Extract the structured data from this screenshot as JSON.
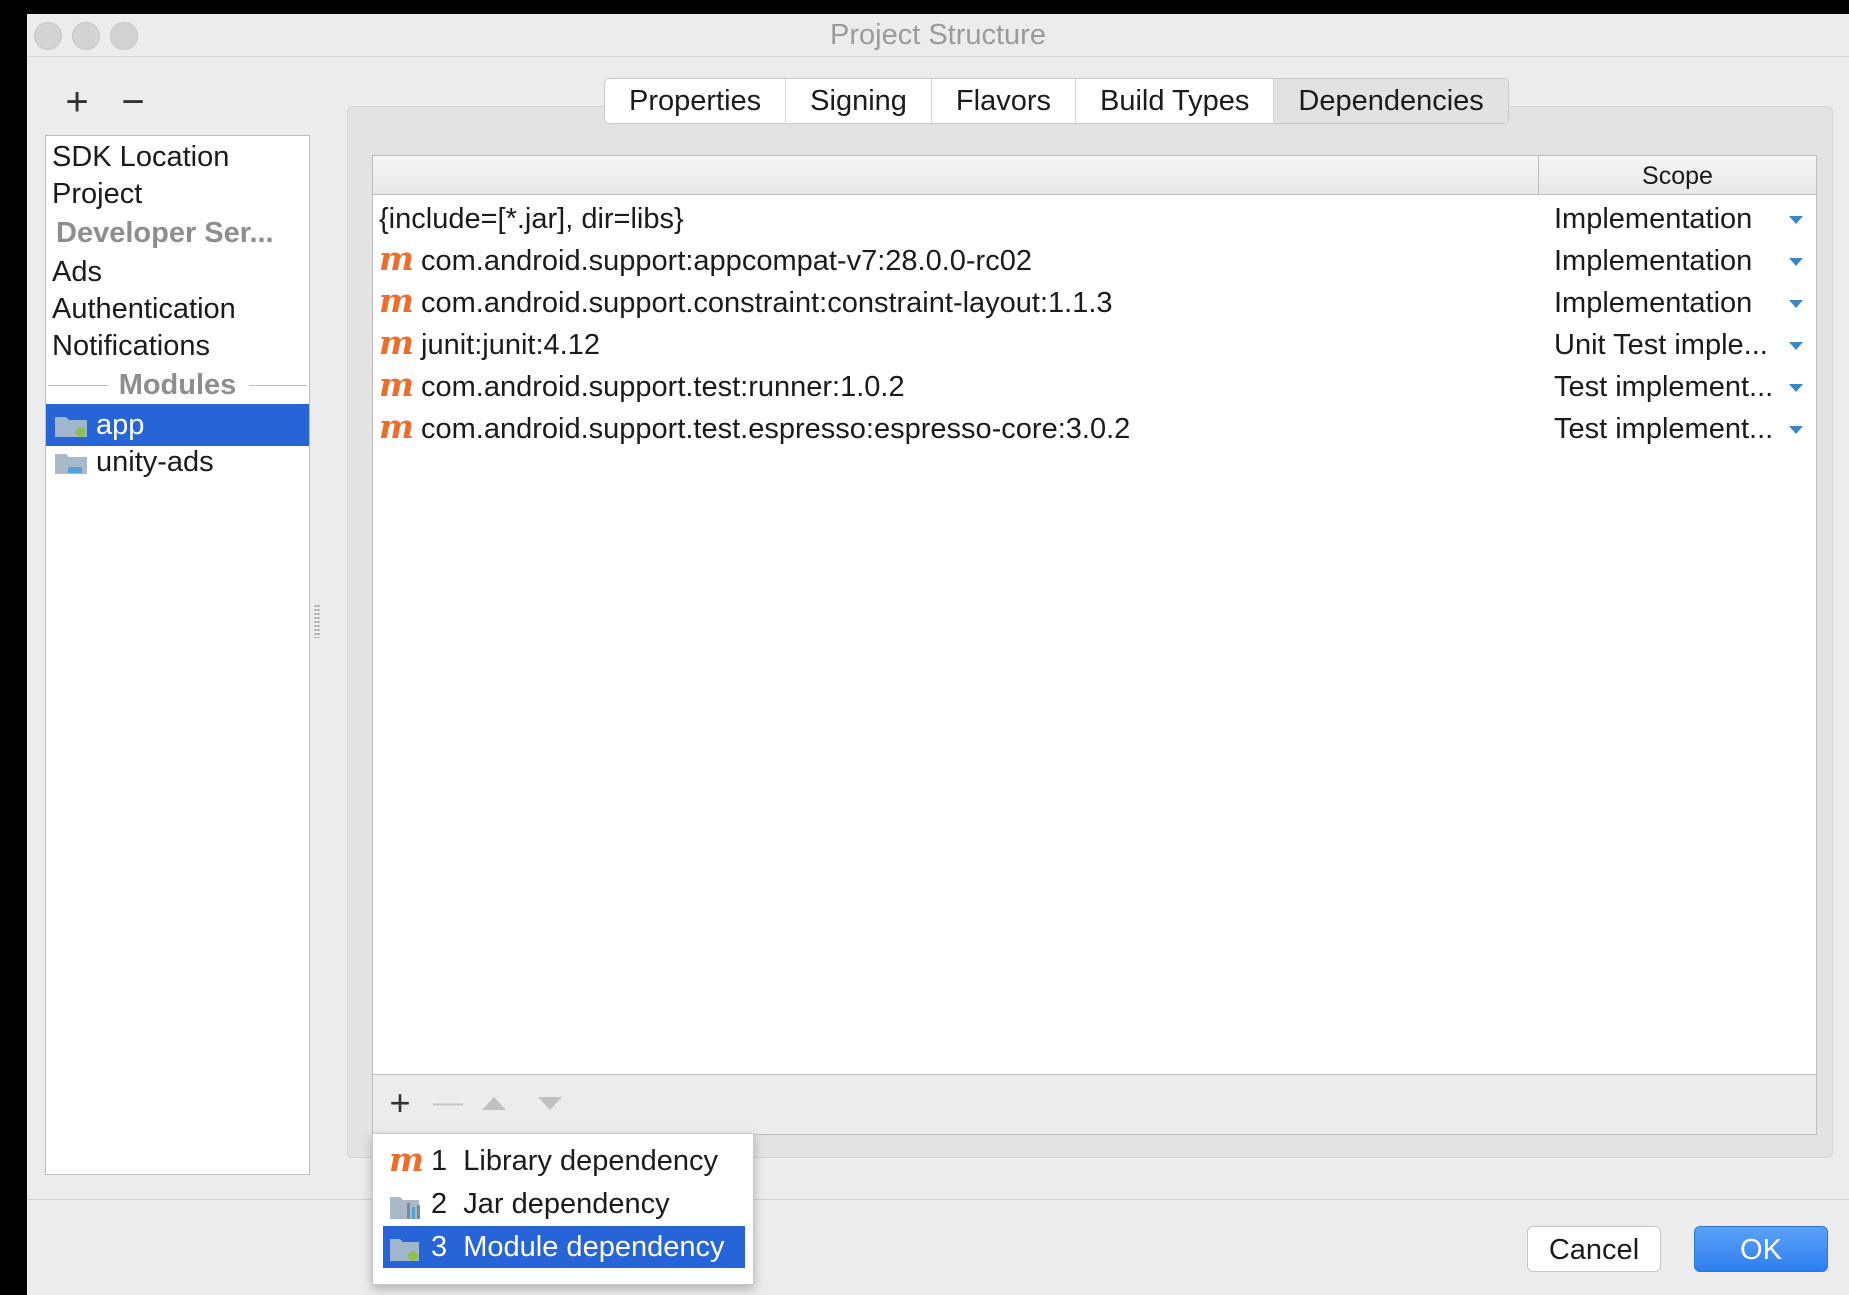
{
  "window": {
    "title": "Project Structure"
  },
  "sidebar": {
    "add_label": "+",
    "remove_label": "−",
    "items": [
      "SDK Location",
      "Project"
    ],
    "developer_header": "Developer Ser...",
    "services": [
      "Ads",
      "Authentication",
      "Notifications"
    ],
    "modules_header": "Modules",
    "modules": [
      {
        "label": "app",
        "selected": true
      },
      {
        "label": "unity-ads",
        "selected": false
      }
    ]
  },
  "tabs": {
    "items": [
      "Properties",
      "Signing",
      "Flavors",
      "Build Types",
      "Dependencies"
    ],
    "active": "Dependencies"
  },
  "table": {
    "columns": {
      "name": "",
      "scope": "Scope"
    },
    "maven_icon_glyph": "m",
    "rows": [
      {
        "icon": "none",
        "name": "{include=[*.jar], dir=libs}",
        "scope": "Implementation"
      },
      {
        "icon": "maven-icon",
        "name": "com.android.support:appcompat-v7:28.0.0-rc02",
        "scope": "Implementation"
      },
      {
        "icon": "maven-icon",
        "name": "com.android.support.constraint:constraint-layout:1.1.3",
        "scope": "Implementation"
      },
      {
        "icon": "maven-icon",
        "name": "junit:junit:4.12",
        "scope": "Unit Test imple..."
      },
      {
        "icon": "maven-icon",
        "name": "com.android.support.test:runner:1.0.2",
        "scope": "Test implement..."
      },
      {
        "icon": "maven-icon",
        "name": "com.android.support.test.espresso:espresso-core:3.0.2",
        "scope": "Test implement..."
      }
    ]
  },
  "toolbar": {
    "add_label": "+",
    "remove_label": "—"
  },
  "popup": {
    "items": [
      {
        "number": "1",
        "label": "Library dependency",
        "icon": "maven-icon"
      },
      {
        "number": "2",
        "label": "Jar dependency",
        "icon": "jar-icon"
      },
      {
        "number": "3",
        "label": "Module dependency",
        "icon": "module-folder-icon",
        "selected": true
      }
    ]
  },
  "buttons": {
    "cancel": "Cancel",
    "ok": "OK"
  },
  "colors": {
    "selection": "#2664d8",
    "maven": "#ef6c2b",
    "ok_button": "#2f7ef0",
    "dropdown_arrow": "#3b86c6"
  }
}
